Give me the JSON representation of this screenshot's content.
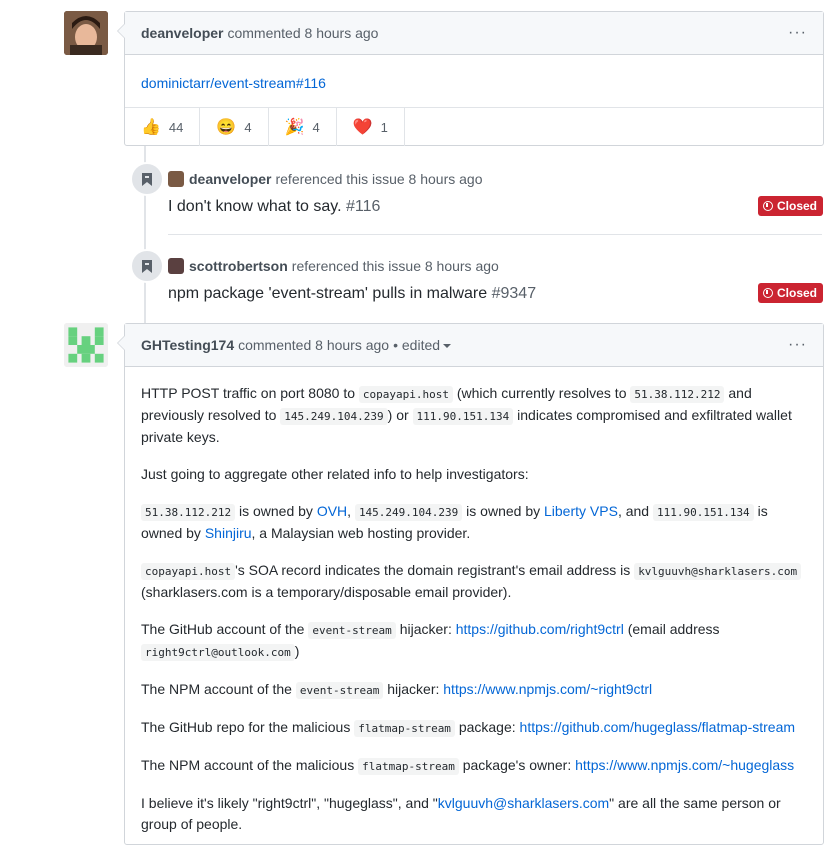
{
  "comment1": {
    "author": "deanveloper",
    "meta": "commented 8 hours ago",
    "link": "dominictarr/event-stream#116",
    "reactions": [
      {
        "emoji": "👍",
        "count": "44"
      },
      {
        "emoji": "😄",
        "count": "4"
      },
      {
        "emoji": "🎉",
        "count": "4"
      },
      {
        "emoji": "❤️",
        "count": "1"
      }
    ]
  },
  "ref1": {
    "author": "deanveloper",
    "meta": "referenced this issue 8 hours ago",
    "title": "I don't know what to say.",
    "number": "#116",
    "status": "Closed"
  },
  "ref2": {
    "author": "scottrobertson",
    "meta": "referenced this issue 8 hours ago",
    "title": "npm package 'event-stream' pulls in malware",
    "number": "#9347",
    "status": "Closed"
  },
  "comment2": {
    "author": "GHTesting174",
    "meta": "commented 8 hours ago",
    "edited": "• edited",
    "p1": {
      "a": "HTTP POST traffic on port 8080 to ",
      "code1": "copayapi.host",
      "b": " (which currently resolves to ",
      "code2": "51.38.112.212",
      "c": " and previously resolved to ",
      "code3": "145.249.104.239",
      "d": ") or ",
      "code4": "111.90.151.134",
      "e": " indicates compromised and exfiltrated wallet private keys."
    },
    "p2": "Just going to aggregate other related info to help investigators:",
    "p3": {
      "code1": "51.38.112.212",
      "a": " is owned by ",
      "link1": "OVH",
      "b": ", ",
      "code2": "145.249.104.239",
      "c": " is owned by ",
      "link2": "Liberty VPS",
      "d": ", and ",
      "code3": "111.90.151.134",
      "e": " is owned by ",
      "link3": "Shinjiru",
      "f": ", a Malaysian web hosting provider."
    },
    "p4": {
      "code1": "copayapi.host",
      "a": "'s SOA record indicates the domain registrant's email address is ",
      "code2": "kvlguuvh@sharklasers.com",
      "b": " (sharklasers.com is a temporary/disposable email provider)."
    },
    "p5": {
      "a": "The GitHub account of the ",
      "code1": "event-stream",
      "b": " hijacker: ",
      "link1": "https://github.com/right9ctrl",
      "c": " (email address ",
      "code2": "right9ctrl@outlook.com",
      "d": ")"
    },
    "p6": {
      "a": "The NPM account of the ",
      "code1": "event-stream",
      "b": " hijacker: ",
      "link1": "https://www.npmjs.com/~right9ctrl"
    },
    "p7": {
      "a": "The GitHub repo for the malicious ",
      "code1": "flatmap-stream",
      "b": " package: ",
      "link1": "https://github.com/hugeglass/flatmap-stream"
    },
    "p8": {
      "a": "The NPM account of the malicious ",
      "code1": "flatmap-stream",
      "b": " package's owner: ",
      "link1": "https://www.npmjs.com/~hugeglass"
    },
    "p9": {
      "a": "I believe it's likely \"right9ctrl\", \"hugeglass\", and \"",
      "link1": "kvlguuvh@sharklasers.com",
      "b": "\" are all the same person or group of people."
    }
  }
}
